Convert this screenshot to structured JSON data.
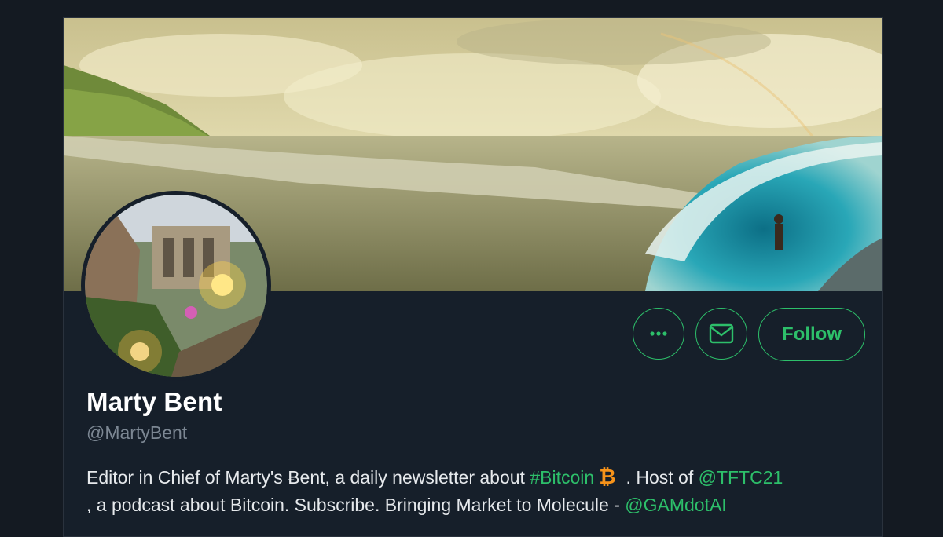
{
  "profile": {
    "name": "Marty Bent",
    "handle": "@MartyBent",
    "bio": {
      "part1": "Editor in Chief of Marty's Ƀent, a daily newsletter about ",
      "hashtag": "#Bitcoin",
      "part2": " . Host of ",
      "mention1": "@TFTC21",
      "part3": " , a podcast about Bitcoin. Subscribe. Bringing Market to Molecule - ",
      "mention2": "@GAMdotAI"
    }
  },
  "actions": {
    "more_icon": "more-horizontal-icon",
    "message_icon": "envelope-icon",
    "follow_label": "Follow"
  },
  "colors": {
    "accent": "#2dbf6a",
    "background": "#161f2a",
    "page": "#141a22",
    "bitcoin": "#f7931a"
  }
}
